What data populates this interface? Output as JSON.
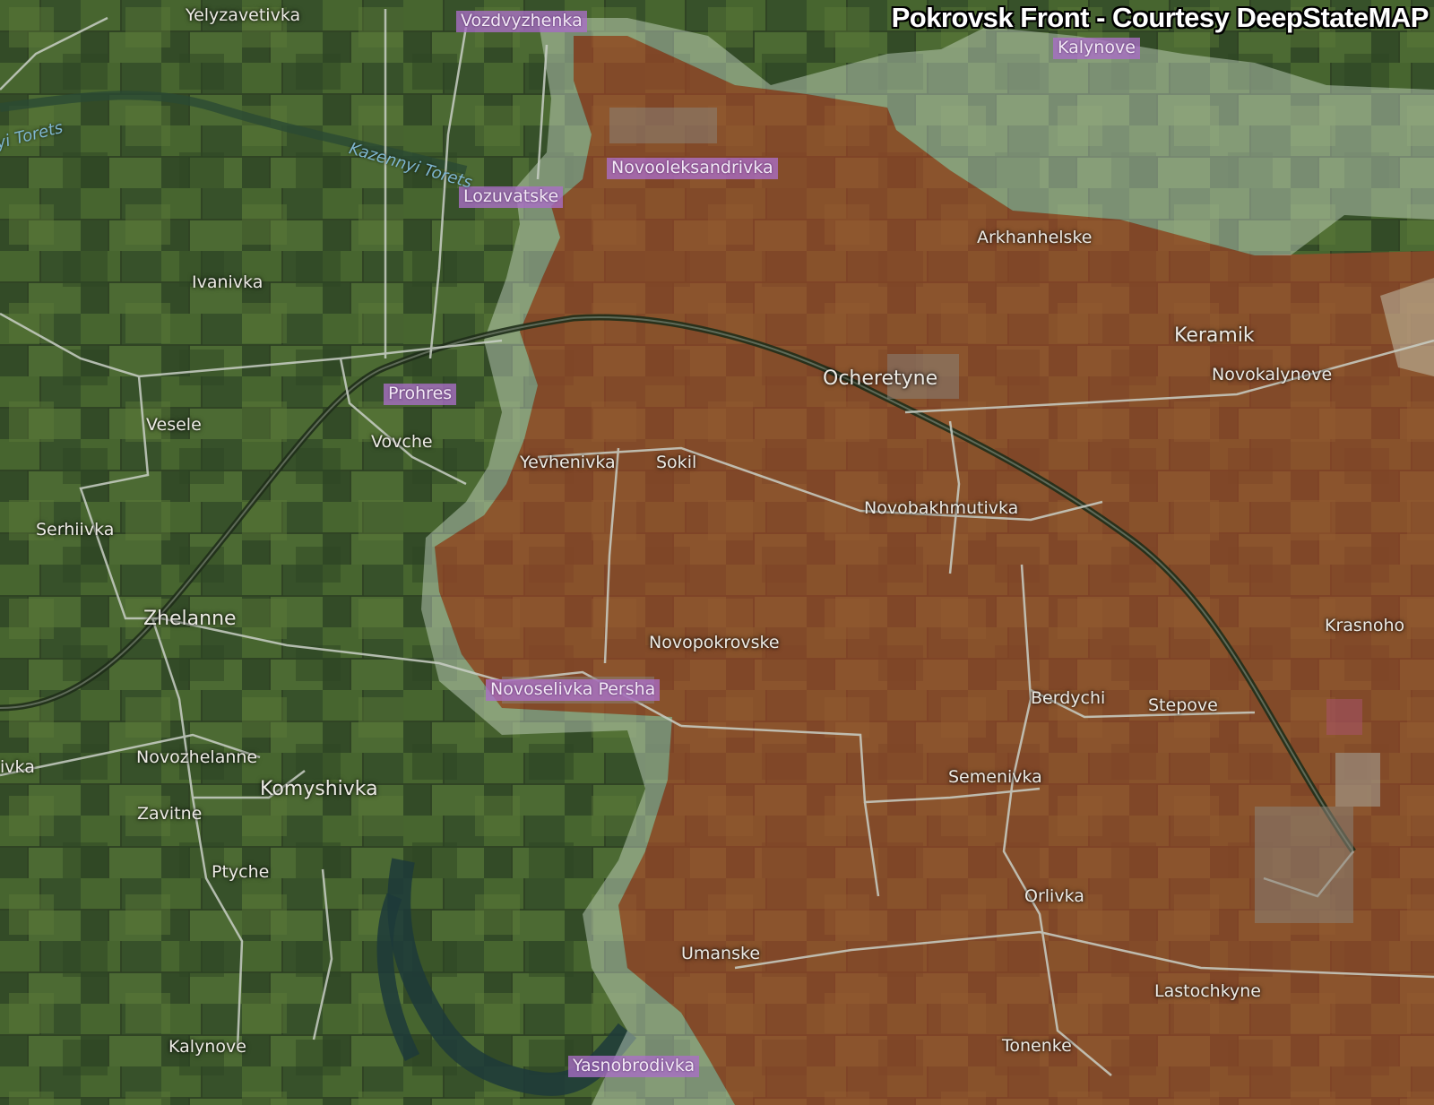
{
  "title": "Pokrovsk Front - Courtesy DeepStateMAP",
  "colors": {
    "farmland_base": "#3d5a2c",
    "occupied_overlay": "#b8452a",
    "contested_overlay": "#d8e8d8",
    "road": "#c9cfc6",
    "highlighted_label": "#aa6ec8"
  },
  "rivers": [
    {
      "id": "river-label-1",
      "text": "yi Torets"
    },
    {
      "id": "river-label-2",
      "text": "Kazennyi Torets"
    }
  ],
  "towns": [
    {
      "id": "yelyzavetivka",
      "text": "Yelyzavetivka"
    },
    {
      "id": "vozdvyzhenka",
      "text": "Vozdvyzhenka",
      "highlight": true
    },
    {
      "id": "kalynove-north",
      "text": "Kalynove",
      "highlight": true
    },
    {
      "id": "novooleksandrivka",
      "text": "Novooleksandrivka",
      "highlight": true
    },
    {
      "id": "lozuvatske",
      "text": "Lozuvatske",
      "highlight": true
    },
    {
      "id": "arkhanhelske",
      "text": "Arkhanhelske"
    },
    {
      "id": "ivanivka",
      "text": "Ivanivka"
    },
    {
      "id": "keramik",
      "text": "Keramik",
      "big": true
    },
    {
      "id": "novokalynove",
      "text": "Novokalynove"
    },
    {
      "id": "ocheretyne",
      "text": "Ocheretyne",
      "big": true
    },
    {
      "id": "prohres",
      "text": "Prohres",
      "highlight": true
    },
    {
      "id": "vesele",
      "text": "Vesele"
    },
    {
      "id": "vovche",
      "text": "Vovche"
    },
    {
      "id": "yevhenivka",
      "text": "Yevhenivka"
    },
    {
      "id": "sokil",
      "text": "Sokil"
    },
    {
      "id": "novobakhmutivka",
      "text": "Novobakhmutivka"
    },
    {
      "id": "serhiivka",
      "text": "Serhiivka"
    },
    {
      "id": "zhelanne",
      "text": "Zhelanne",
      "big": true
    },
    {
      "id": "novopokrovske",
      "text": "Novopokrovske"
    },
    {
      "id": "krasnohorivka",
      "text": "Krasnoho"
    },
    {
      "id": "novoselivka-persha",
      "text": "Novoselivka Persha",
      "highlight": true
    },
    {
      "id": "berdychi",
      "text": "Berdychi"
    },
    {
      "id": "stepove",
      "text": "Stepove"
    },
    {
      "id": "ivka-west",
      "text": "ivka"
    },
    {
      "id": "novozhelanne",
      "text": "Novozhelanne"
    },
    {
      "id": "komyshivka",
      "text": "Komyshivka",
      "big": true
    },
    {
      "id": "semenivka",
      "text": "Semenivka"
    },
    {
      "id": "zavitne",
      "text": "Zavitne"
    },
    {
      "id": "ptyche",
      "text": "Ptyche"
    },
    {
      "id": "orlivka",
      "text": "Orlivka"
    },
    {
      "id": "umanske",
      "text": "Umanske"
    },
    {
      "id": "lastochkyne",
      "text": "Lastochkyne"
    },
    {
      "id": "kalynove-south",
      "text": "Kalynove"
    },
    {
      "id": "tonenke",
      "text": "Tonenke"
    },
    {
      "id": "yasnobrodivka",
      "text": "Yasnobrodivka",
      "highlight": true
    }
  ]
}
